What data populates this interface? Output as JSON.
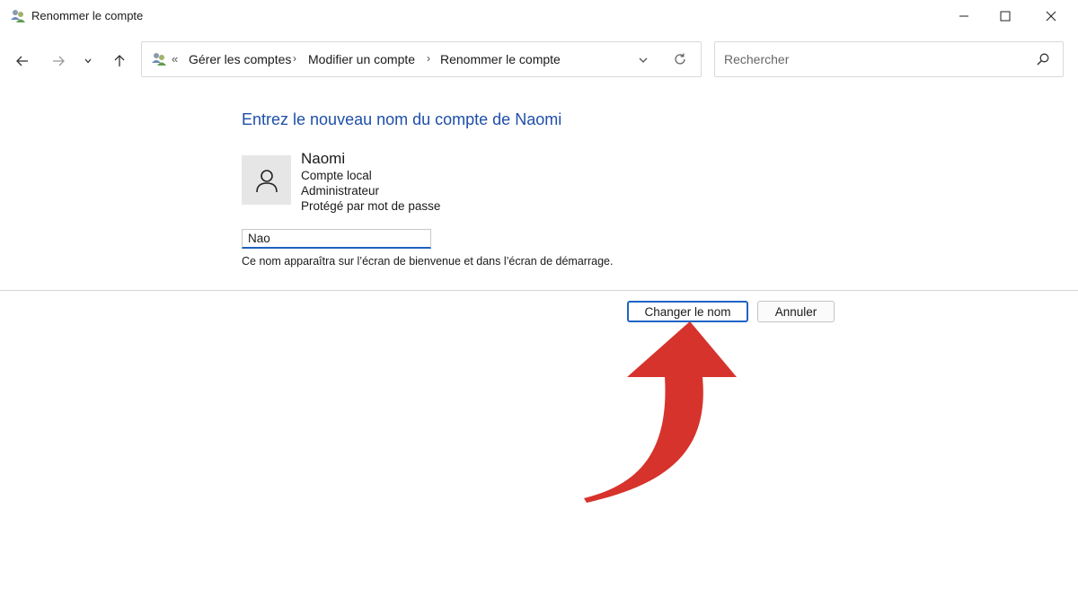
{
  "window": {
    "title": "Renommer le compte"
  },
  "nav": {
    "breadcrumb_overflow": "«",
    "breadcrumbs": [
      "Gérer les comptes",
      "Modifier un compte",
      "Renommer le compte"
    ],
    "separator": "›",
    "search_placeholder": "Rechercher"
  },
  "content": {
    "heading": "Entrez le nouveau nom du compte de Naomi",
    "account": {
      "name": "Naomi",
      "type": "Compte local",
      "role": "Administrateur",
      "security": "Protégé par mot de passe"
    },
    "new_name_value": "Nao",
    "hint": "Ce nom apparaîtra sur l’écran de bienvenue et dans l’écran de démarrage."
  },
  "actions": {
    "rename_label": "Changer le nom",
    "cancel_label": "Annuler"
  },
  "colors": {
    "heading": "#1e4fa8",
    "accent": "#1f63c6",
    "annotation_arrow": "#d6332c"
  },
  "icons": {
    "app": "users-icon",
    "back": "arrow-left-icon",
    "forward": "arrow-right-icon",
    "recent": "chevron-down-icon",
    "up": "arrow-up-icon",
    "refresh": "refresh-icon",
    "search": "search-icon",
    "avatar": "user-icon"
  }
}
